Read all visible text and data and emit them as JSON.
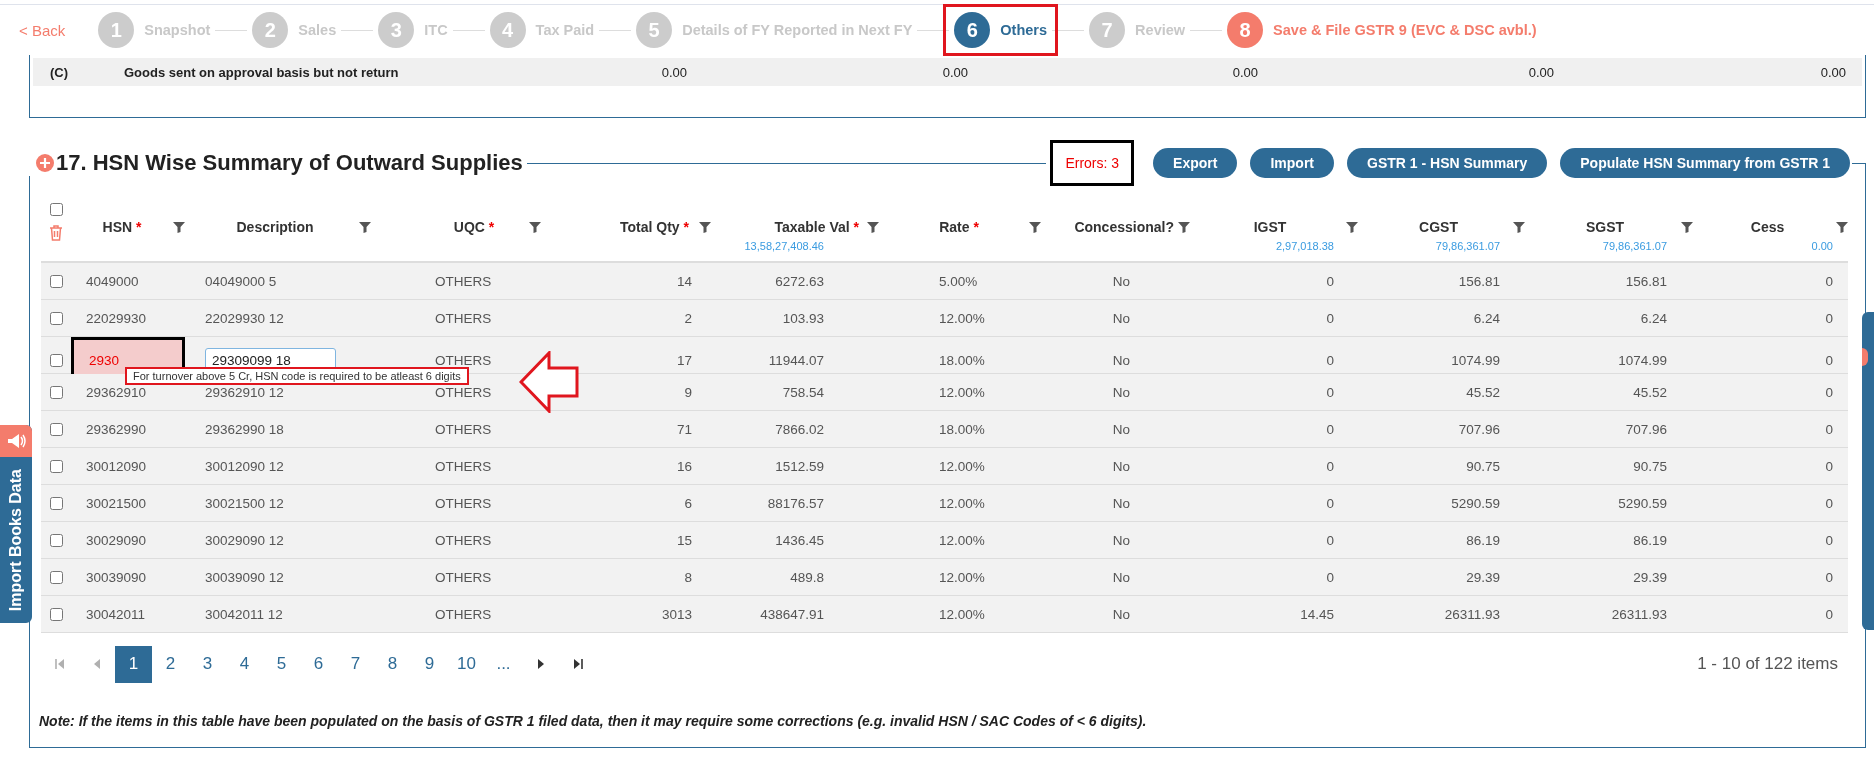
{
  "stepper": {
    "back": "< Back",
    "steps": [
      {
        "number": "1",
        "label": "Snapshot",
        "kind": "step",
        "selected": false,
        "highlighted": false
      },
      {
        "number": "2",
        "label": "Sales",
        "kind": "step",
        "selected": false,
        "highlighted": false
      },
      {
        "number": "3",
        "label": "ITC",
        "kind": "step",
        "selected": false,
        "highlighted": false
      },
      {
        "number": "4",
        "label": "Tax Paid",
        "kind": "step",
        "selected": false,
        "highlighted": false
      },
      {
        "number": "5",
        "label": "Details of FY Reported in Next FY",
        "kind": "step",
        "selected": false,
        "highlighted": false
      },
      {
        "number": "6",
        "label": "Others",
        "kind": "step",
        "selected": true,
        "highlighted": true
      },
      {
        "number": "7",
        "label": "Review",
        "kind": "step",
        "selected": false,
        "highlighted": false
      },
      {
        "number": "8",
        "label": "Save & File GSTR 9 (EVC & DSC avbl.)",
        "kind": "final",
        "selected": false,
        "highlighted": false
      }
    ]
  },
  "previous_table": {
    "row": {
      "label": "(C)",
      "description": "Goods sent on approval basis but not return",
      "values": [
        "0.00",
        "0.00",
        "0.00",
        "0.00",
        "0.00"
      ]
    }
  },
  "hsn_section": {
    "title": "17. HSN Wise Summary of Outward Supplies",
    "errors": "Errors: 3",
    "buttons": [
      "Export",
      "Import",
      "GSTR 1 - HSN Summary",
      "Populate HSN Summary from GSTR 1"
    ],
    "table": {
      "select_all": false,
      "columns": [
        {
          "label": "HSN",
          "marker": "*"
        },
        {
          "label": "Description"
        },
        {
          "label": "UQC",
          "marker": "*"
        },
        {
          "label": "Total Qty",
          "marker": "*"
        },
        {
          "label": "Taxable Val",
          "marker": "*",
          "total": "13,58,27,408.46"
        },
        {
          "label": "Rate",
          "marker": "*"
        },
        {
          "label": "Concessional?"
        },
        {
          "label": "IGST",
          "total": "2,97,018.38"
        },
        {
          "label": "CGST",
          "total": "79,86,361.07"
        },
        {
          "label": "SGST",
          "total": "79,86,361.07"
        },
        {
          "label": "Cess",
          "total": "0.00"
        }
      ],
      "rows": [
        {
          "checked": false,
          "hsn_error": false,
          "editing": false,
          "cells": [
            "4049000",
            "04049000 5",
            "OTHERS",
            "14",
            "6272.63",
            "5.00%",
            "No",
            "0",
            "156.81",
            "156.81",
            "0"
          ]
        },
        {
          "checked": false,
          "hsn_error": false,
          "editing": false,
          "cells": [
            "22029930",
            "22029930 12",
            "OTHERS",
            "2",
            "103.93",
            "12.00%",
            "No",
            "0",
            "6.24",
            "6.24",
            "0"
          ]
        },
        {
          "checked": false,
          "hsn_error": true,
          "editing": true,
          "tooltip": "For turnover above 5 Cr, HSN code is required to be atleast 6 digits",
          "cells": [
            "2930",
            "29309099 18",
            "OTHERS",
            "17",
            "11944.07",
            "18.00%",
            "No",
            "0",
            "1074.99",
            "1074.99",
            "0"
          ]
        },
        {
          "checked": false,
          "hsn_error": false,
          "editing": false,
          "cells": [
            "29362910",
            "29362910 12",
            "OTHERS",
            "9",
            "758.54",
            "12.00%",
            "No",
            "0",
            "45.52",
            "45.52",
            "0"
          ]
        },
        {
          "checked": false,
          "hsn_error": false,
          "editing": false,
          "cells": [
            "29362990",
            "29362990 18",
            "OTHERS",
            "71",
            "7866.02",
            "18.00%",
            "No",
            "0",
            "707.96",
            "707.96",
            "0"
          ]
        },
        {
          "checked": false,
          "hsn_error": false,
          "editing": false,
          "cells": [
            "30012090",
            "30012090 12",
            "OTHERS",
            "16",
            "1512.59",
            "12.00%",
            "No",
            "0",
            "90.75",
            "90.75",
            "0"
          ]
        },
        {
          "checked": false,
          "hsn_error": false,
          "editing": false,
          "cells": [
            "30021500",
            "30021500 12",
            "OTHERS",
            "6",
            "88176.57",
            "12.00%",
            "No",
            "0",
            "5290.59",
            "5290.59",
            "0"
          ]
        },
        {
          "checked": false,
          "hsn_error": false,
          "editing": false,
          "cells": [
            "30029090",
            "30029090 12",
            "OTHERS",
            "15",
            "1436.45",
            "12.00%",
            "No",
            "0",
            "86.19",
            "86.19",
            "0"
          ]
        },
        {
          "checked": false,
          "hsn_error": false,
          "editing": false,
          "cells": [
            "30039090",
            "30039090 12",
            "OTHERS",
            "8",
            "489.8",
            "12.00%",
            "No",
            "0",
            "29.39",
            "29.39",
            "0"
          ]
        },
        {
          "checked": false,
          "hsn_error": false,
          "editing": false,
          "cells": [
            "30042011",
            "30042011 12",
            "OTHERS",
            "3013",
            "438647.91",
            "12.00%",
            "No",
            "14.45",
            "26311.93",
            "26311.93",
            "0"
          ]
        }
      ]
    },
    "pagination": {
      "first_disabled": true,
      "prev_disabled": true,
      "next_disabled": false,
      "last_disabled": false,
      "pages": [
        {
          "label": "1",
          "selected": true
        },
        {
          "label": "2",
          "selected": false
        },
        {
          "label": "3",
          "selected": false
        },
        {
          "label": "4",
          "selected": false
        },
        {
          "label": "5",
          "selected": false
        },
        {
          "label": "6",
          "selected": false
        },
        {
          "label": "7",
          "selected": false
        },
        {
          "label": "8",
          "selected": false
        },
        {
          "label": "9",
          "selected": false
        },
        {
          "label": "10",
          "selected": false
        }
      ],
      "more": "...",
      "summary": "1 - 10 of 122 items"
    },
    "note": "Note: If the items in this table have been populated on the basis of GSTR 1 filed data, then it may require some corrections (e.g. invalid HSN / SAC Codes of < 6 digits)."
  },
  "import_tab": {
    "label": "Import Books Data"
  }
}
